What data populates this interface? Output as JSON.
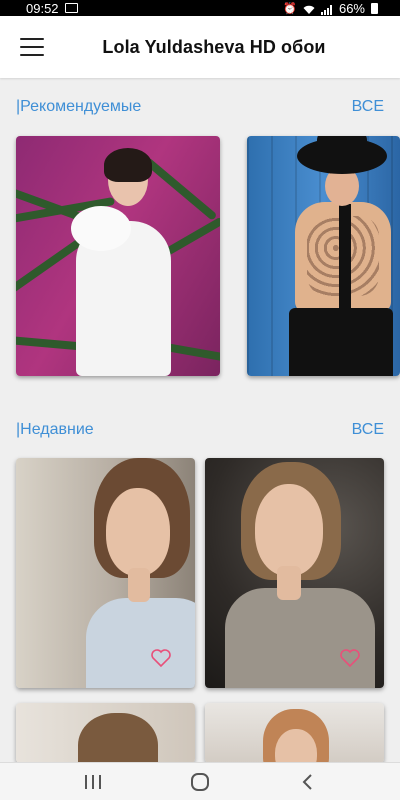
{
  "status_bar": {
    "time": "09:52",
    "battery": "66%",
    "icons": [
      "image-icon",
      "alarm-icon",
      "wifi-icon",
      "signal-icon",
      "battery-icon"
    ]
  },
  "app_bar": {
    "title": "Lola Yuldasheva HD обои",
    "menu_icon": "hamburger-menu-icon"
  },
  "sections": {
    "featured": {
      "title": "|Рекомендуемые",
      "see_all": "ВСЕ"
    },
    "recent": {
      "title": "|Недавние",
      "see_all": "ВСЕ"
    }
  },
  "colors": {
    "accent": "#3f8fd6",
    "background": "#efefef",
    "heart": "#e8507a"
  },
  "nav_bar": {
    "icons": [
      "recent-apps-icon",
      "home-icon",
      "back-icon"
    ]
  }
}
